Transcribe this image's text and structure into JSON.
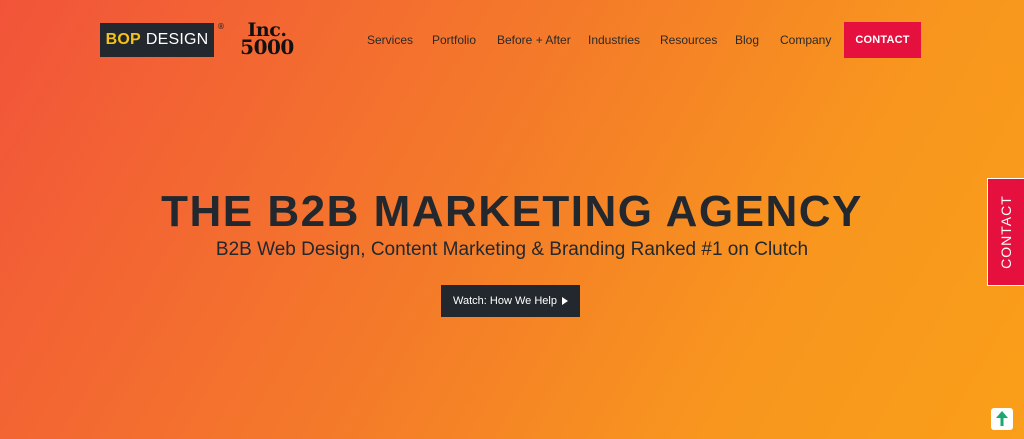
{
  "header": {
    "logo_bop": "BOP",
    "logo_design": "DESIGN",
    "logo_reg": "®",
    "inc_top": "Inc.",
    "inc_bottom": "5000",
    "nav": {
      "services": "Services",
      "portfolio": "Portfolio",
      "before_after": "Before + After",
      "industries": "Industries",
      "resources": "Resources",
      "blog": "Blog",
      "company": "Company"
    },
    "contact_label": "CONTACT"
  },
  "hero": {
    "title": "THE B2B MARKETING AGENCY",
    "subtitle": "B2B Web Design, Content Marketing & Branding Ranked #1 on Clutch",
    "watch_label": "Watch: How We Help"
  },
  "side_tab": {
    "label": "CONTACT"
  },
  "icons": {
    "play": "play-icon",
    "scroll_top": "arrow-up-icon"
  },
  "colors": {
    "accent_red": "#e5103e",
    "dark": "#22282d",
    "logo_yellow": "#f4c21a",
    "bg_start": "#f2543a",
    "bg_end": "#fa9f19",
    "badge_green": "#1aa871"
  }
}
